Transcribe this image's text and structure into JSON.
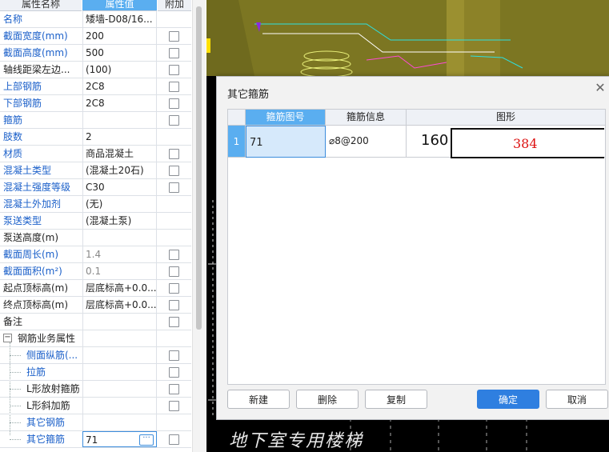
{
  "property_panel": {
    "headers": {
      "name": "属性名称",
      "value": "属性值",
      "extra": "附加"
    },
    "rows": [
      {
        "name": "名称",
        "value": "矮墙-D08/16...",
        "name_blue": true,
        "checkbox": false
      },
      {
        "name": "截面宽度(mm)",
        "value": "200",
        "name_blue": true,
        "checkbox": true
      },
      {
        "name": "截面高度(mm)",
        "value": "500",
        "name_blue": true,
        "checkbox": true
      },
      {
        "name": "轴线距梁左边...",
        "value": "(100)",
        "name_blue": false,
        "checkbox": true
      },
      {
        "name": "上部钢筋",
        "value": "2C8",
        "name_blue": true,
        "checkbox": true
      },
      {
        "name": "下部钢筋",
        "value": "2C8",
        "name_blue": true,
        "checkbox": true
      },
      {
        "name": "箍筋",
        "value": "",
        "name_blue": true,
        "checkbox": true
      },
      {
        "name": "肢数",
        "value": "2",
        "name_blue": true,
        "checkbox": false
      },
      {
        "name": "材质",
        "value": "商品混凝土",
        "name_blue": true,
        "checkbox": true
      },
      {
        "name": "混凝土类型",
        "value": "(混凝土20石)",
        "name_blue": true,
        "checkbox": true
      },
      {
        "name": "混凝土强度等级",
        "value": "C30",
        "name_blue": true,
        "checkbox": true
      },
      {
        "name": "混凝土外加剂",
        "value": "(无)",
        "name_blue": true,
        "checkbox": false
      },
      {
        "name": "泵送类型",
        "value": "(混凝土泵)",
        "name_blue": true,
        "checkbox": false
      },
      {
        "name": "泵送高度(m)",
        "value": "",
        "name_blue": false,
        "checkbox": false
      },
      {
        "name": "截面周长(m)",
        "value": "1.4",
        "name_blue": true,
        "checkbox": true,
        "value_gray": true
      },
      {
        "name": "截面面积(m²)",
        "value": "0.1",
        "name_blue": true,
        "checkbox": true,
        "value_gray": true
      },
      {
        "name": "起点顶标高(m)",
        "value": "层底标高+0.0...",
        "name_blue": false,
        "checkbox": true
      },
      {
        "name": "终点顶标高(m)",
        "value": "层底标高+0.0...",
        "name_blue": false,
        "checkbox": true
      },
      {
        "name": "备注",
        "value": "",
        "name_blue": false,
        "checkbox": true
      }
    ],
    "group": {
      "label": "钢筋业务属性",
      "expander": "−"
    },
    "group_rows": [
      {
        "name": "侧面纵筋(...",
        "value": "",
        "name_blue": true,
        "checkbox": true
      },
      {
        "name": "拉筋",
        "value": "",
        "name_blue": true,
        "checkbox": true
      },
      {
        "name": "L形放射箍筋",
        "value": "",
        "name_blue": false,
        "checkbox": true
      },
      {
        "name": "L形斜加筋",
        "value": "",
        "name_blue": false,
        "checkbox": true
      },
      {
        "name": "其它钢筋",
        "value": "",
        "name_blue": true,
        "checkbox": false
      },
      {
        "name": "其它箍筋",
        "value": "71",
        "name_blue": true,
        "checkbox": true,
        "editing": true,
        "ellipsis": "···"
      }
    ]
  },
  "cad": {
    "caption": "地下室专用楼梯"
  },
  "dialog": {
    "title": "其它箍筋",
    "columns": {
      "code": "箍筋图号",
      "info": "箍筋信息",
      "shape": "图形"
    },
    "rows": [
      {
        "index": "1",
        "code": "71",
        "info": "⌀8@200",
        "shape_left": "160",
        "shape_len": "384"
      }
    ],
    "buttons": {
      "new": "新建",
      "delete": "删除",
      "copy": "复制",
      "ok": "确定",
      "cancel": "取消"
    }
  },
  "colors": {
    "accent": "#5aaef0",
    "link_blue": "#1a5fc9",
    "primary_button": "#2f7fe0",
    "shape_red": "#dd1111"
  }
}
